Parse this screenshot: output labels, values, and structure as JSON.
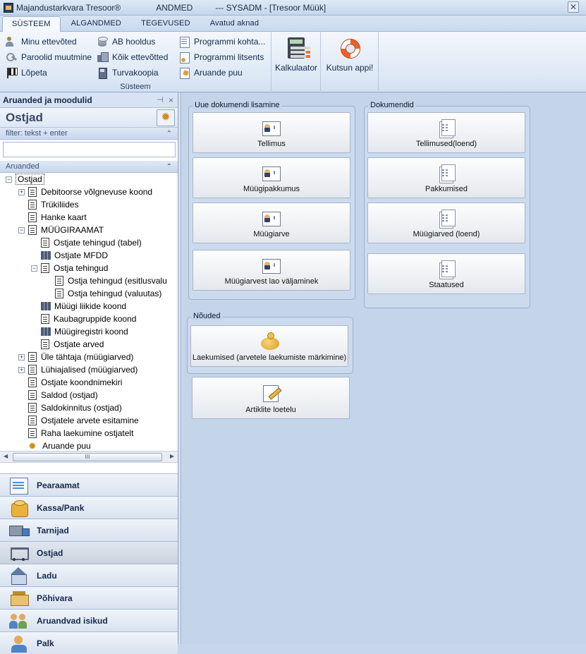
{
  "window": {
    "title_app": "Majandustarkvara Tresoor®",
    "title_db": "ANDMED",
    "title_user": "--- SYSADM - [Tresoor Müük]"
  },
  "ribbon": {
    "tabs": [
      "SÜSTEEM",
      "ALGANDMED",
      "TEGEVUSED",
      "Avatud aknad"
    ],
    "active_tab": "SÜSTEEM",
    "group_title": "Süsteem",
    "col1": [
      "Minu ettevõted",
      "Paroolid muutmine",
      "Lõpeta"
    ],
    "col2": [
      "AB hooldus",
      "Kõik ettevõtted",
      "Turvakoopia"
    ],
    "col3": [
      "Programmi kohta...",
      "Programmi litsents",
      "Aruande puu"
    ],
    "calc_label": "Kalkulaator",
    "help_label": "Kutsun appi!"
  },
  "leftpanel": {
    "header": "Aruanded ja moodulid",
    "pin": "📌",
    "close": "×",
    "module_title": "Ostjad",
    "filter_label": "filter: tekst + enter",
    "filter_value": "",
    "reports_label": "Aruanded",
    "tree": [
      {
        "label": "Ostjad",
        "level": 0,
        "expander": "−",
        "icon": "none"
      },
      {
        "label": "Debitoorse võlgnevuse koond",
        "level": 1,
        "expander": "+",
        "icon": "doc"
      },
      {
        "label": "Trükiliides",
        "level": 1,
        "expander": "",
        "icon": "doc"
      },
      {
        "label": "Hanke kaart",
        "level": 1,
        "expander": "",
        "icon": "doc"
      },
      {
        "label": "MÜÜGIRAAMAT",
        "level": 1,
        "expander": "−",
        "icon": "doc"
      },
      {
        "label": "Ostjate tehingud (tabel)",
        "level": 2,
        "expander": "",
        "icon": "doc"
      },
      {
        "label": "Ostjate MFDD",
        "level": 2,
        "expander": "",
        "icon": "table"
      },
      {
        "label": "Ostja tehingud",
        "level": 2,
        "expander": "−",
        "icon": "doc"
      },
      {
        "label": "Ostja tehingud (esitlusvalu",
        "level": 3,
        "expander": "",
        "icon": "doc"
      },
      {
        "label": "Ostja tehingud (valuutas)",
        "level": 3,
        "expander": "",
        "icon": "doc"
      },
      {
        "label": "Müügi liikide koond",
        "level": 2,
        "expander": "",
        "icon": "table"
      },
      {
        "label": "Kaubagruppide koond",
        "level": 2,
        "expander": "",
        "icon": "doc"
      },
      {
        "label": "Müügiregistri koond",
        "level": 2,
        "expander": "",
        "icon": "table"
      },
      {
        "label": "Ostjate arved",
        "level": 2,
        "expander": "",
        "icon": "doc"
      },
      {
        "label": "Üle tähtaja (müügiarved)",
        "level": 1,
        "expander": "+",
        "icon": "doc"
      },
      {
        "label": "Lühiajalised (müügiarved)",
        "level": 1,
        "expander": "+",
        "icon": "doc"
      },
      {
        "label": "Ostjate koondnimekiri",
        "level": 1,
        "expander": "",
        "icon": "doc"
      },
      {
        "label": "Saldod (ostjad)",
        "level": 1,
        "expander": "",
        "icon": "doc"
      },
      {
        "label": "Saldokinnitus (ostjad)",
        "level": 1,
        "expander": "",
        "icon": "doc"
      },
      {
        "label": "Ostjatele arvete esitamine",
        "level": 1,
        "expander": "",
        "icon": "doc"
      },
      {
        "label": "Raha laekumine ostjatelt",
        "level": 1,
        "expander": "",
        "icon": "doc"
      },
      {
        "label": "Aruande puu",
        "level": 1,
        "expander": "",
        "icon": "gear"
      }
    ],
    "scroll_grip": "III",
    "nav": [
      {
        "label": "Pearaamat",
        "icon": "ledger-icon"
      },
      {
        "label": "Kassa/Pank",
        "icon": "coins-icon"
      },
      {
        "label": "Tarnijad",
        "icon": "truck-icon"
      },
      {
        "label": "Ostjad",
        "icon": "cart-icon",
        "active": true
      },
      {
        "label": "Ladu",
        "icon": "warehouse-icon"
      },
      {
        "label": "Põhivara",
        "icon": "asset-icon"
      },
      {
        "label": "Aruandvad isikud",
        "icon": "people-icon"
      },
      {
        "label": "Palk",
        "icon": "salary-icon"
      }
    ]
  },
  "main": {
    "new_doc_group": "Uue dokumendi lisamine",
    "new_docs": [
      "Tellimus",
      "Müügipakkumus",
      "Müügiarve",
      "Müügiarvest lao väljaminek"
    ],
    "docs_group": "Dokumendid",
    "docs": [
      "Tellimused(loend)",
      "Pakkumised",
      "Müügiarved (loend)",
      "Staatused"
    ],
    "claims_group": "Nõuded",
    "claims_tile": "Laekumised (arvetele laekumiste märkimine)",
    "articles_tile": "Artiklite loetelu"
  }
}
